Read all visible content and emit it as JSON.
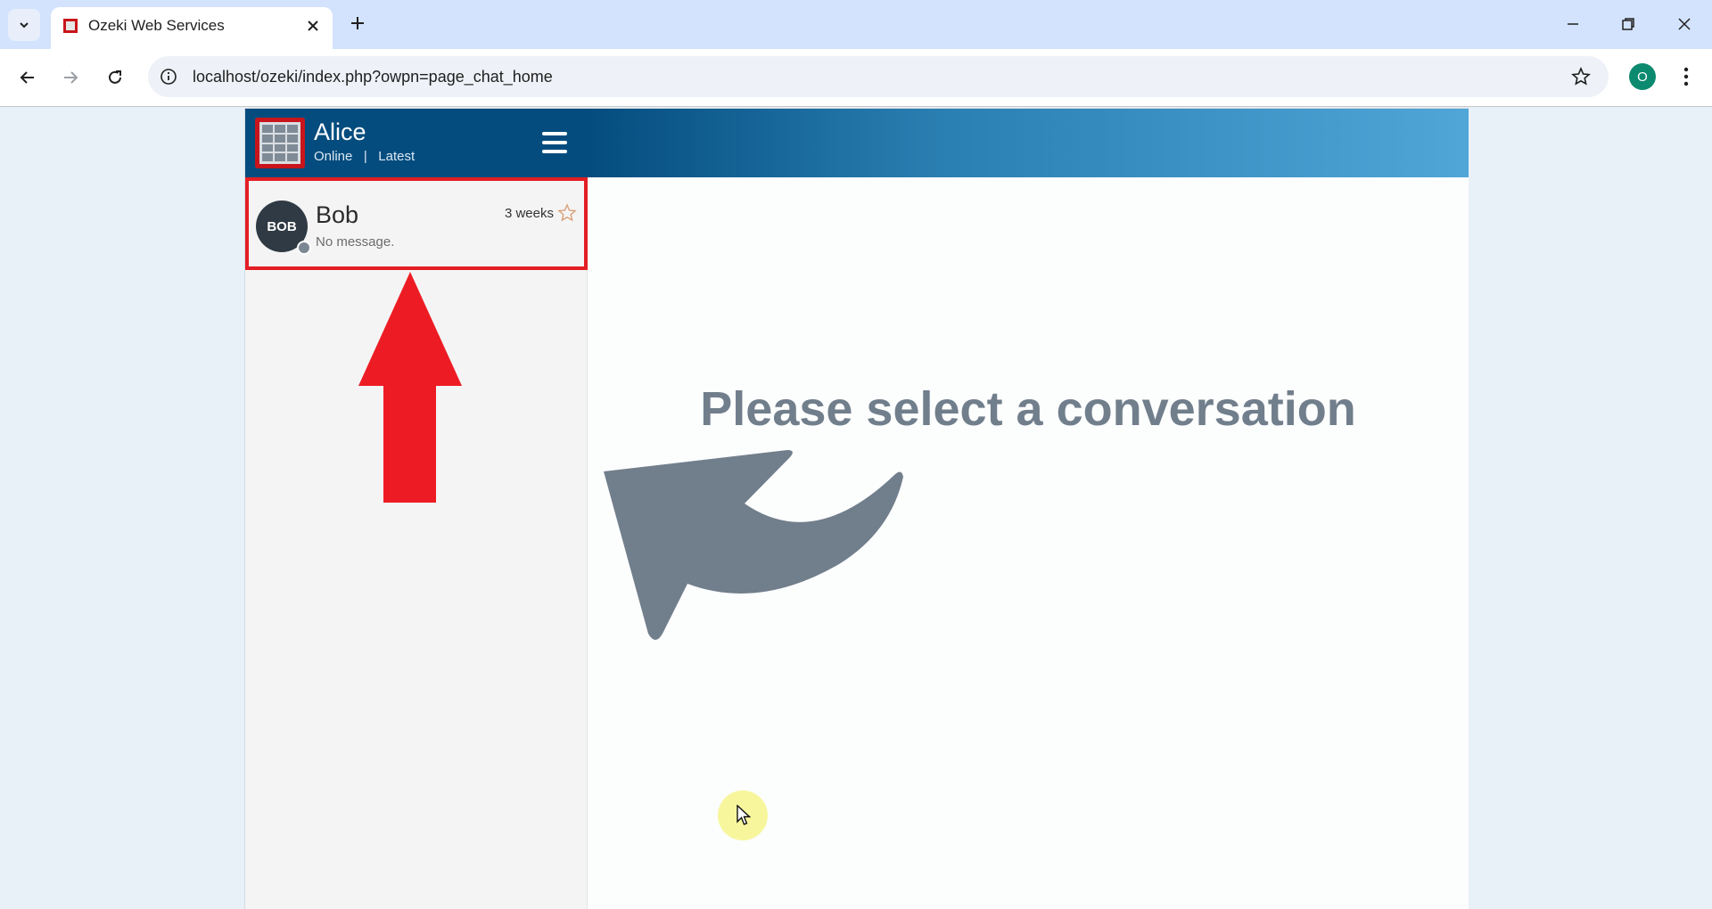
{
  "browser": {
    "tab_title": "Ozeki Web Services",
    "url": "localhost/ozeki/index.php?owpn=page_chat_home",
    "profile_initial": "O"
  },
  "sidebar": {
    "user_name": "Alice",
    "status_line": "Online   |   Latest",
    "conversations": [
      {
        "avatar_text": "BOB",
        "name": "Bob",
        "time": "3 weeks",
        "preview": "No message."
      }
    ]
  },
  "main": {
    "prompt": "Please select a conversation"
  },
  "colors": {
    "header_dark": "#044c7e",
    "highlight_red": "#e31e24",
    "prompt_gray": "#717e8c"
  }
}
